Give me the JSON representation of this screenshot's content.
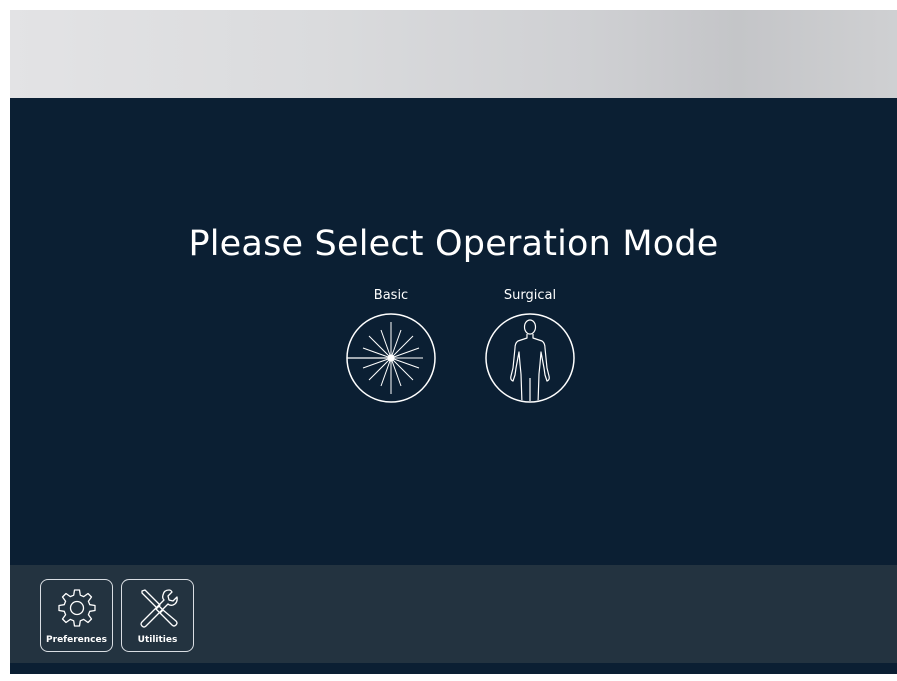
{
  "main": {
    "title": "Please Select Operation Mode",
    "modes": [
      {
        "label": "Basic",
        "icon": "laser-burst-icon"
      },
      {
        "label": "Surgical",
        "icon": "human-body-icon"
      }
    ]
  },
  "toolbar": {
    "preferences_label": "Preferences",
    "preferences_icon": "gear-icon",
    "utilities_label": "Utilities",
    "utilities_icon": "wrench-screwdriver-icon"
  },
  "colors": {
    "background": "#0b1f33",
    "toolbar": "#233340",
    "text": "#ffffff"
  }
}
